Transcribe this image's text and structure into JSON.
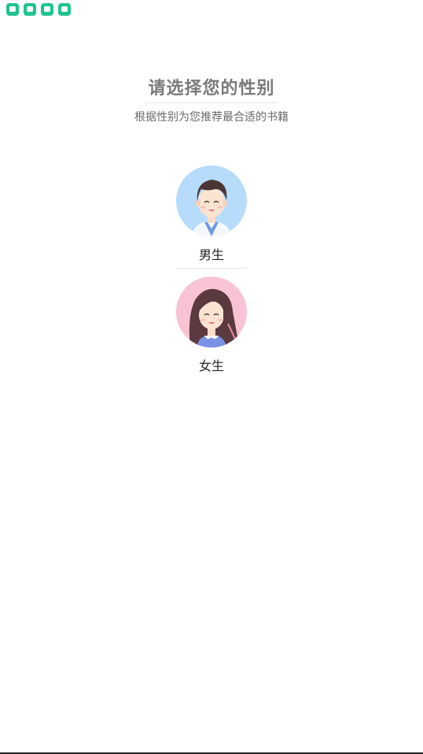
{
  "status_bar": {
    "notification_icons": [
      "app-notification-icon",
      "app-notification-icon",
      "app-notification-icon",
      "app-notification-icon"
    ],
    "icon_color": "#1fc48e"
  },
  "header": {
    "title": "请选择您的性别",
    "subtitle": "根据性别为您推荐最合适的书籍"
  },
  "options": {
    "male": {
      "label": "男生",
      "icon": "male-avatar-icon",
      "bg_color": "#b7dcfb"
    },
    "female": {
      "label": "女生",
      "icon": "female-avatar-icon",
      "bg_color": "#f8c3d4"
    }
  }
}
